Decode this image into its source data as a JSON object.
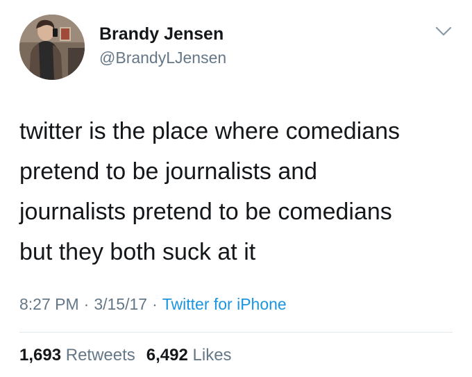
{
  "author": {
    "display_name": "Brandy Jensen",
    "handle": "@BrandyLJensen"
  },
  "tweet": {
    "lines": [
      "twitter is the place where comedians",
      "pretend to be journalists and",
      "journalists pretend to be comedians",
      "but they both suck at it"
    ]
  },
  "meta": {
    "time": "8:27 PM",
    "separator": "·",
    "date": "3/15/17",
    "source": "Twitter for iPhone"
  },
  "stats": {
    "retweets_count": "1,693",
    "retweets_label": "Retweets",
    "likes_count": "6,492",
    "likes_label": "Likes"
  },
  "icons": {
    "caret": "chevron-down-icon"
  },
  "colors": {
    "text": "#14171a",
    "secondary": "#657786",
    "link": "#1b95e0",
    "divider": "#e1e8ed"
  }
}
